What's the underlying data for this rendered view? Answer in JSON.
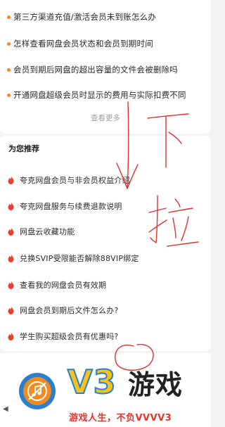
{
  "faq": {
    "items": [
      "第三方渠道充值/激活会员未到账怎么办",
      "怎样查看网盘会员状态和会员到期时间",
      "会员到期后网盘的超出容量的文件会被删除吗",
      "开通网盘超级会员时显示的费用与实际扣费不同"
    ],
    "see_more": "查看更多"
  },
  "recommend": {
    "title": "为您推荐",
    "items": [
      "夸克网盘会员与非会员权益介绍",
      "夸克网盘服务与续费退款说明",
      "网盘云收藏功能",
      "兑换SVIP受限能否解除88VIP绑定",
      "查看我的网盘会员有效期",
      "网盘会员到期后文件怎么办?",
      "学生购买超级会员有优惠吗?"
    ]
  },
  "annotation": {
    "text": "下拉"
  },
  "watermark": {
    "brand_v3": "V3",
    "brand_game": "游戏",
    "slogan": "游戏人生，不负VVVV3"
  },
  "colors": {
    "accent_orange": "#f28a1e",
    "flame_red": "#e8402e",
    "annotation_red": "#e0322a",
    "watermark_yellow": "#f7c21a",
    "watermark_blue": "#2a7fd1"
  }
}
